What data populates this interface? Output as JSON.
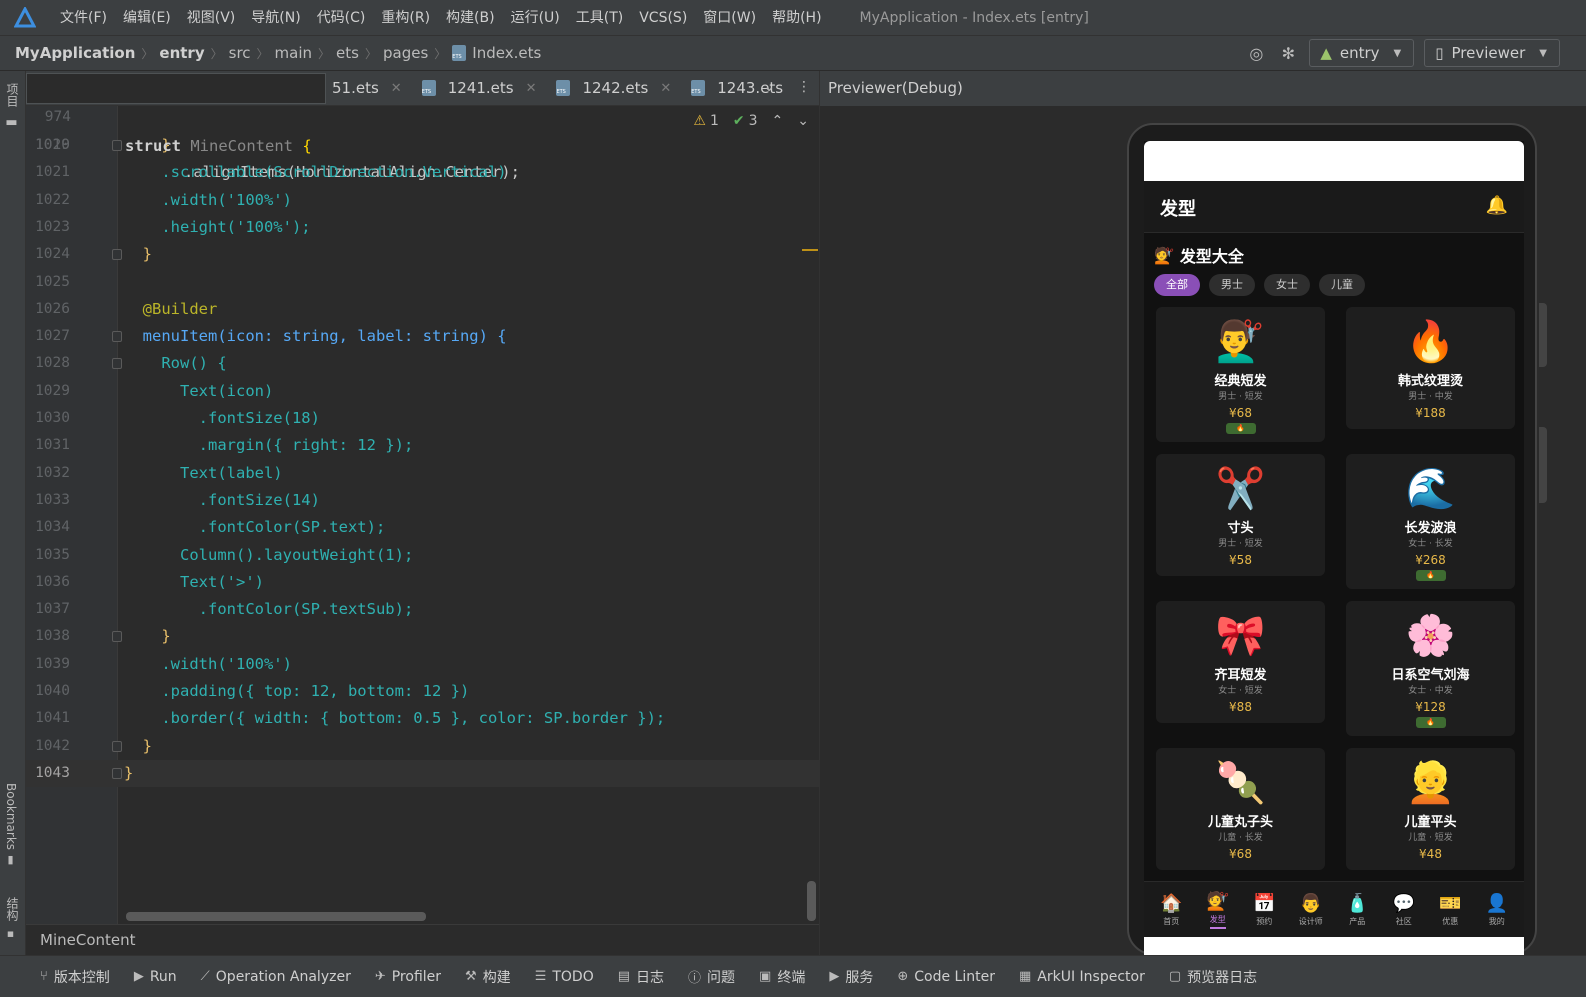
{
  "menubar": {
    "items": [
      "文件(F)",
      "编辑(E)",
      "视图(V)",
      "导航(N)",
      "代码(C)",
      "重构(R)",
      "构建(B)",
      "运行(U)",
      "工具(T)",
      "VCS(S)",
      "窗口(W)",
      "帮助(H)"
    ],
    "window_title": "MyApplication - Index.ets [entry]"
  },
  "breadcrumb": {
    "items": [
      "MyApplication",
      "entry",
      "src",
      "main",
      "ets",
      "pages",
      "Index.ets"
    ]
  },
  "toolbar": {
    "module_label": "entry",
    "device_label": "Previewer"
  },
  "left_strip": {
    "project_label": "项目",
    "bookmarks_label": "Bookmarks",
    "structure_label": "结构"
  },
  "editor": {
    "tabs": [
      "51.ets",
      "1241.ets",
      "1242.ets",
      "1243.ets"
    ],
    "sticky": {
      "line": "974",
      "text": "struct MineContent {"
    },
    "warnings": "1",
    "checks": "3",
    "partial_line_text": ".alignItems(HorizontalAlign.Center);",
    "partial_line_number": "1019",
    "lines": [
      {
        "n": "1020",
        "t": "    }"
      },
      {
        "n": "1021",
        "t": "    .scrollable(ScrollDirection.Vertical)"
      },
      {
        "n": "1022",
        "t": "    .width('100%')"
      },
      {
        "n": "1023",
        "t": "    .height('100%');"
      },
      {
        "n": "1024",
        "t": "  }"
      },
      {
        "n": "1025",
        "t": ""
      },
      {
        "n": "1026",
        "t": "  @Builder"
      },
      {
        "n": "1027",
        "t": "  menuItem(icon: string, label: string) {"
      },
      {
        "n": "1028",
        "t": "    Row() {"
      },
      {
        "n": "1029",
        "t": "      Text(icon)"
      },
      {
        "n": "1030",
        "t": "        .fontSize(18)"
      },
      {
        "n": "1031",
        "t": "        .margin({ right: 12 });"
      },
      {
        "n": "1032",
        "t": "      Text(label)"
      },
      {
        "n": "1033",
        "t": "        .fontSize(14)"
      },
      {
        "n": "1034",
        "t": "        .fontColor(SP.text);"
      },
      {
        "n": "1035",
        "t": "      Column().layoutWeight(1);"
      },
      {
        "n": "1036",
        "t": "      Text('>')"
      },
      {
        "n": "1037",
        "t": "        .fontColor(SP.textSub);"
      },
      {
        "n": "1038",
        "t": "    }"
      },
      {
        "n": "1039",
        "t": "    .width('100%')"
      },
      {
        "n": "1040",
        "t": "    .padding({ top: 12, bottom: 12 })"
      },
      {
        "n": "1041",
        "t": "    .border({ width: { bottom: 0.5 }, color: SP.border });"
      },
      {
        "n": "1042",
        "t": "  }"
      },
      {
        "n": "1043",
        "t": "}"
      }
    ],
    "status_text": "MineContent"
  },
  "previewer": {
    "title": "Previewer(Debug)",
    "app": {
      "header_title": "发型",
      "section_title": "发型大全",
      "section_icon": "💇",
      "chips": [
        "全部",
        "男士",
        "女士",
        "儿童"
      ],
      "cards": [
        {
          "emoji": "💇‍♂️",
          "name": "经典短发",
          "meta": "男士 · 短发",
          "price": "¥68",
          "hot": true
        },
        {
          "emoji": "🔥",
          "name": "韩式纹理烫",
          "meta": "男士 · 中发",
          "price": "¥188",
          "hot": false
        },
        {
          "emoji": "✂️",
          "name": "寸头",
          "meta": "男士 · 短发",
          "price": "¥58",
          "hot": false
        },
        {
          "emoji": "🌊",
          "name": "长发波浪",
          "meta": "女士 · 长发",
          "price": "¥268",
          "hot": true
        },
        {
          "emoji": "🎀",
          "name": "齐耳短发",
          "meta": "女士 · 短发",
          "price": "¥88",
          "hot": false
        },
        {
          "emoji": "🌸",
          "name": "日系空气刘海",
          "meta": "女士 · 中发",
          "price": "¥128",
          "hot": true
        },
        {
          "emoji": "🍡",
          "name": "儿童丸子头",
          "meta": "儿童 · 长发",
          "price": "¥68",
          "hot": false
        },
        {
          "emoji": "👱",
          "name": "儿童平头",
          "meta": "儿童 · 短发",
          "price": "¥48",
          "hot": false
        }
      ],
      "tabbar": [
        {
          "icon": "🏠",
          "label": "首页"
        },
        {
          "icon": "💇",
          "label": "发型",
          "active": true
        },
        {
          "icon": "📅",
          "label": "预约"
        },
        {
          "icon": "👨",
          "label": "设计师"
        },
        {
          "icon": "🧴",
          "label": "产品"
        },
        {
          "icon": "💬",
          "label": "社区"
        },
        {
          "icon": "🎫",
          "label": "优惠"
        },
        {
          "icon": "👤",
          "label": "我的"
        }
      ]
    }
  },
  "bottom_bar": {
    "items": [
      "版本控制",
      "Run",
      "Operation Analyzer",
      "Profiler",
      "构建",
      "TODO",
      "日志",
      "问题",
      "终端",
      "服务",
      "Code Linter",
      "ArkUI Inspector",
      "预览器日志"
    ]
  },
  "colors": {
    "accent_purple": "#8a4fb7",
    "price_gold": "#e8b949",
    "ide_bg": "#2b2b2b",
    "ide_panel": "#3c3f41"
  }
}
